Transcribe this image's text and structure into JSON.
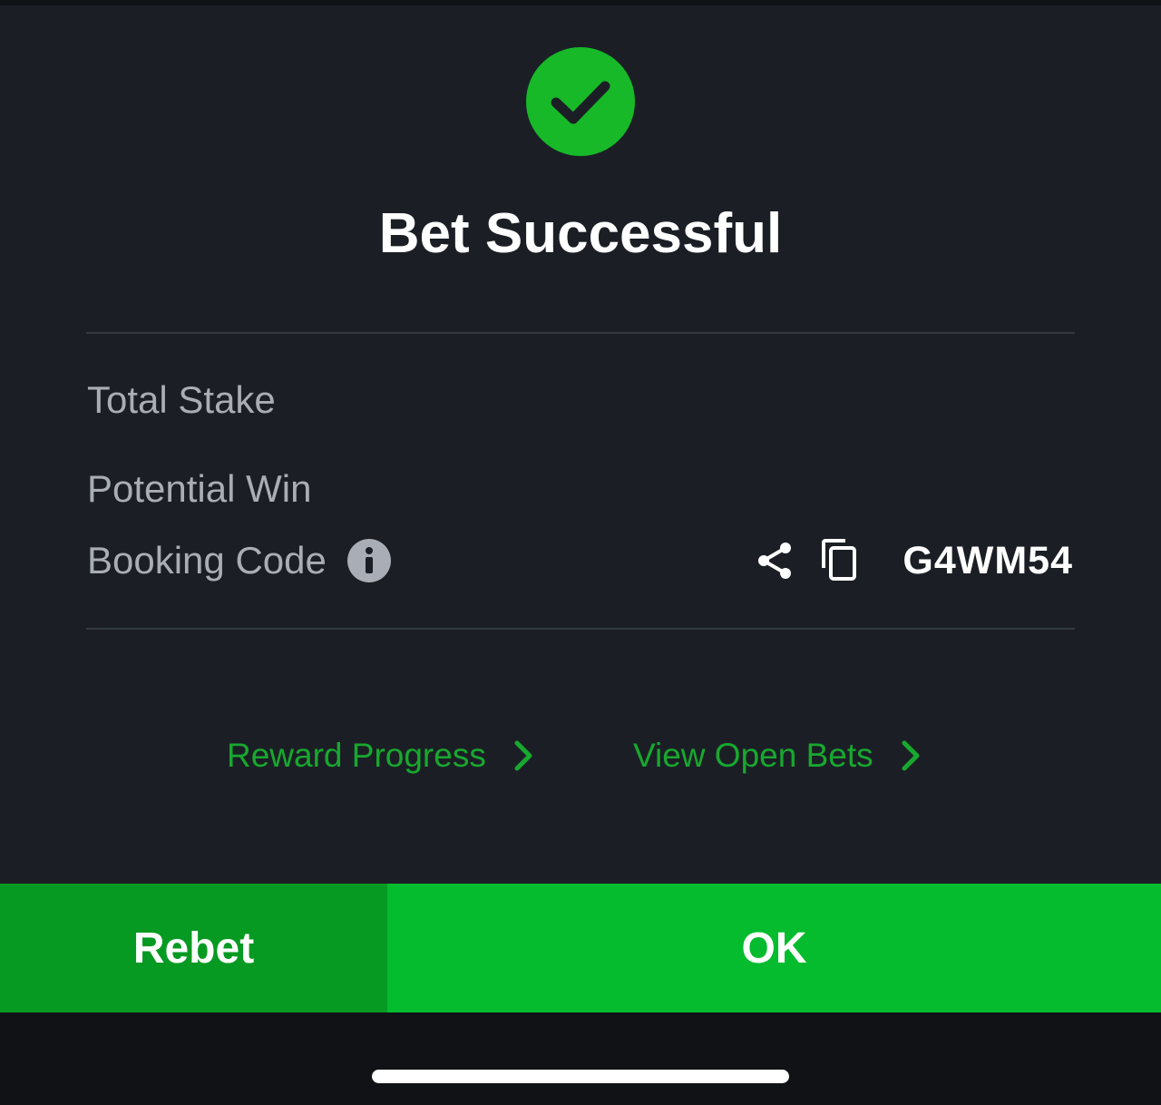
{
  "title": "Bet Successful",
  "rows": {
    "total_stake_label": "Total Stake",
    "potential_win_label": "Potential Win",
    "booking_code_label": "Booking Code",
    "booking_code_value": "G4WM54"
  },
  "links": {
    "reward_progress": "Reward Progress",
    "view_open_bets": "View Open Bets"
  },
  "buttons": {
    "rebet": "Rebet",
    "ok": "OK"
  },
  "icons": {
    "success": "checkmark-icon",
    "info": "info-icon",
    "share": "share-icon",
    "copy": "copy-icon",
    "chevron": "chevron-right-icon"
  },
  "colors": {
    "background": "#1b1f25",
    "accent_green": "#04bc2e",
    "rebet_green": "#079a22",
    "link_green": "#18a82f",
    "muted_text": "#a8adb6"
  }
}
